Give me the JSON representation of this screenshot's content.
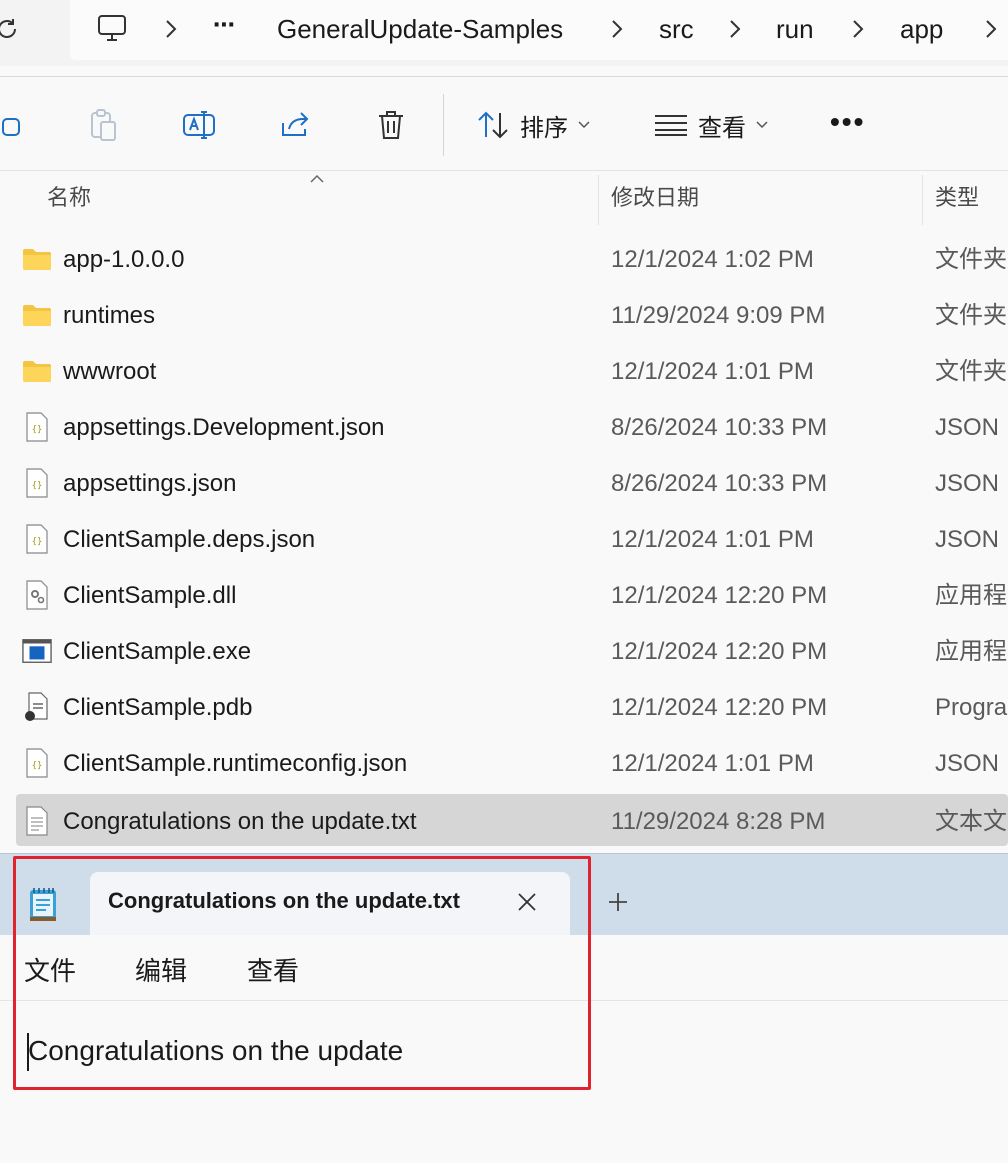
{
  "breadcrumb": {
    "overflow": "⋯",
    "items": [
      "GeneralUpdate-Samples",
      "src",
      "run",
      "app"
    ]
  },
  "toolbar": {
    "sort_label": "排序",
    "view_label": "查看",
    "more_label": "•••"
  },
  "columns": {
    "name": "名称",
    "date": "修改日期",
    "type": "类型"
  },
  "files": [
    {
      "name": "app-1.0.0.0",
      "date": "12/1/2024 1:02 PM",
      "type": "文件夹",
      "icon": "folder-icon"
    },
    {
      "name": "runtimes",
      "date": "11/29/2024 9:09 PM",
      "type": "文件夹",
      "icon": "folder-icon"
    },
    {
      "name": "wwwroot",
      "date": "12/1/2024 1:01 PM",
      "type": "文件夹",
      "icon": "folder-icon"
    },
    {
      "name": "appsettings.Development.json",
      "date": "8/26/2024 10:33 PM",
      "type": "JSON",
      "icon": "json-file-icon"
    },
    {
      "name": "appsettings.json",
      "date": "8/26/2024 10:33 PM",
      "type": "JSON",
      "icon": "json-file-icon"
    },
    {
      "name": "ClientSample.deps.json",
      "date": "12/1/2024 1:01 PM",
      "type": "JSON",
      "icon": "json-file-icon"
    },
    {
      "name": "ClientSample.dll",
      "date": "12/1/2024 12:20 PM",
      "type": "应用程",
      "icon": "dll-file-icon"
    },
    {
      "name": "ClientSample.exe",
      "date": "12/1/2024 12:20 PM",
      "type": "应用程",
      "icon": "exe-file-icon"
    },
    {
      "name": "ClientSample.pdb",
      "date": "12/1/2024 12:20 PM",
      "type": "Progra",
      "icon": "pdb-file-icon"
    },
    {
      "name": "ClientSample.runtimeconfig.json",
      "date": "12/1/2024 1:01 PM",
      "type": "JSON",
      "icon": "json-file-icon"
    },
    {
      "name": "Congratulations on the update.txt",
      "date": "11/29/2024 8:28 PM",
      "type": "文本文",
      "icon": "text-file-icon",
      "selected": true
    }
  ],
  "notepad": {
    "tab_title": "Congratulations on the update.txt",
    "menu": [
      "文件",
      "编辑",
      "查看"
    ],
    "content": "Congratulations on the update"
  },
  "colors": {
    "highlight": "#e0242f",
    "selection": "#d6d6d6",
    "notepad_titlebar": "#cfdcea",
    "folder": "#f4c542"
  }
}
